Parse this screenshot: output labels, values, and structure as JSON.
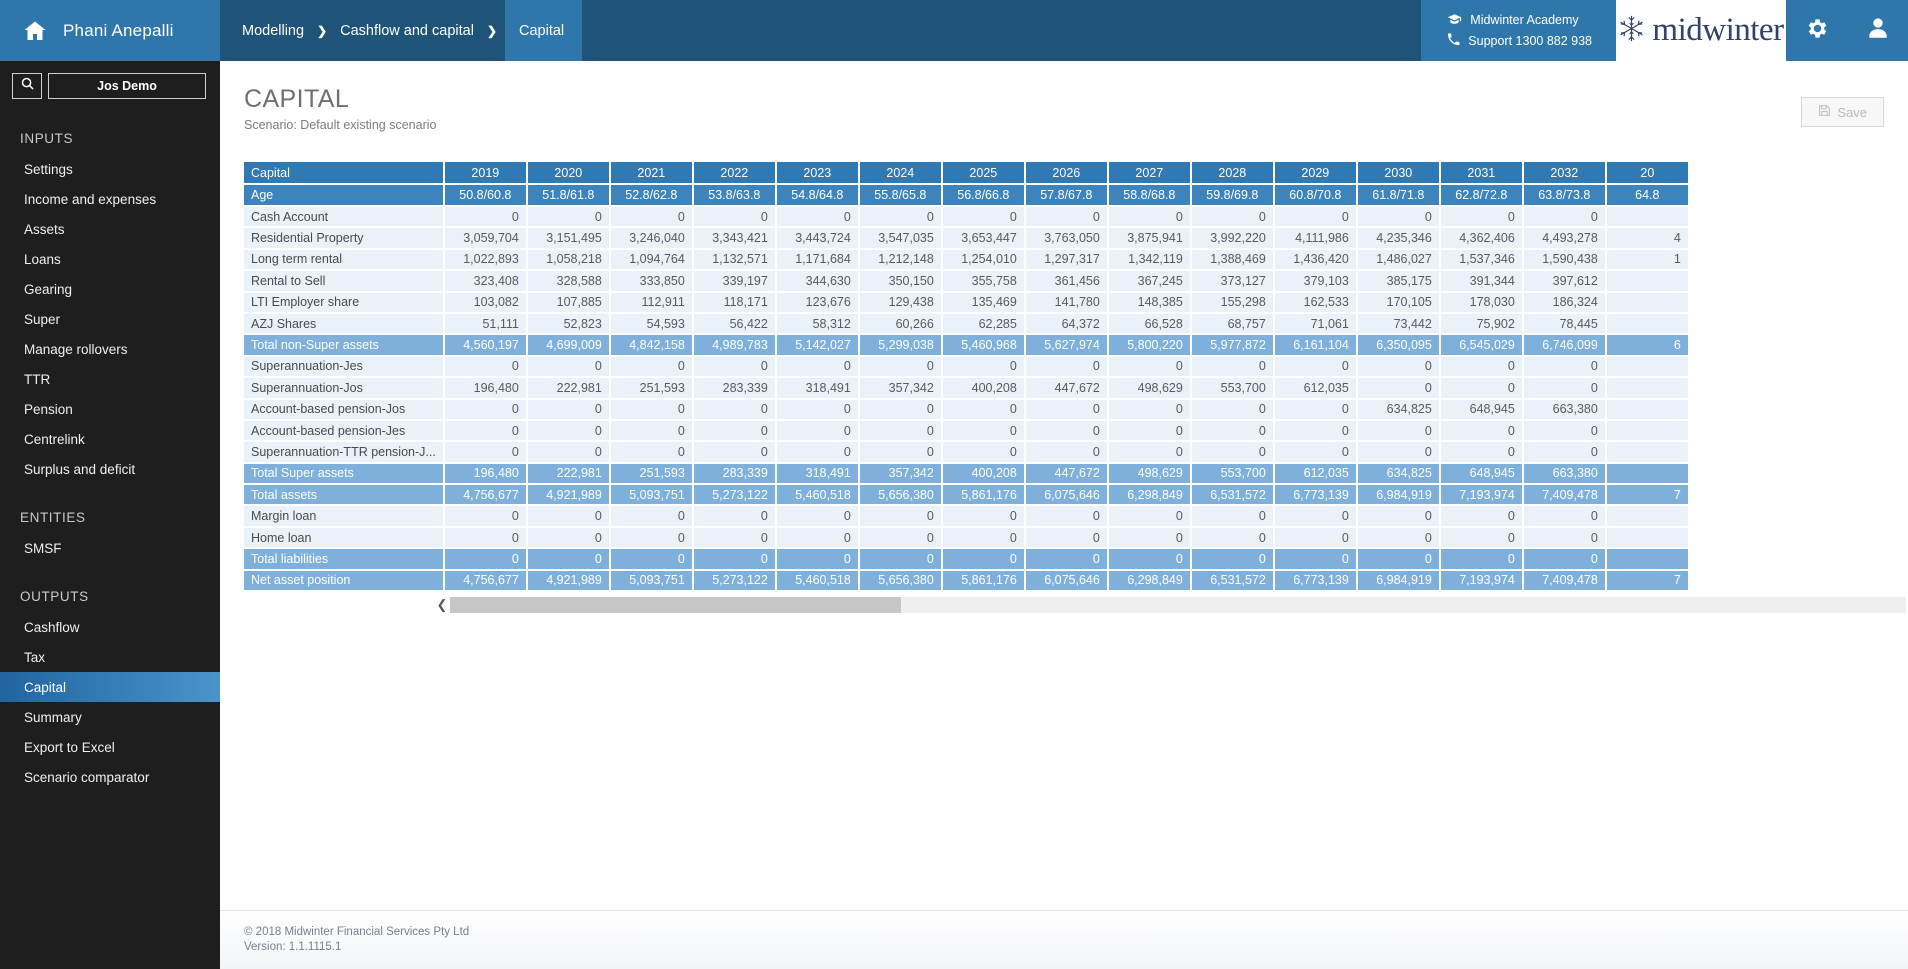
{
  "header": {
    "brand_name": "Phani Anepalli",
    "home_icon": "home-icon",
    "breadcrumbs": [
      "Modelling",
      "Cashflow and capital",
      "Capital"
    ],
    "crumb_separator": "❯",
    "academy_label": "Midwinter Academy",
    "academy_icon": "graduation-cap-icon",
    "support_label": "Support 1300 882 938",
    "support_icon": "phone-icon",
    "logo_text": "midwinter",
    "logo_icon": "snowflake-icon",
    "settings_icon": "gear-icon",
    "user_icon": "user-icon"
  },
  "sidebar": {
    "search_icon": "search-icon",
    "client_label": "Jos Demo",
    "groups": [
      {
        "title": "INPUTS",
        "items": [
          "Settings",
          "Income and expenses",
          "Assets",
          "Loans",
          "Gearing",
          "Super",
          "Manage rollovers",
          "TTR",
          "Pension",
          "Centrelink",
          "Surplus and deficit"
        ]
      },
      {
        "title": "ENTITIES",
        "items": [
          "SMSF"
        ]
      },
      {
        "title": "OUTPUTS",
        "items": [
          "Cashflow",
          "Tax",
          "Capital",
          "Summary",
          "Export to Excel",
          "Scenario comparator"
        ]
      }
    ],
    "active_item": "Capital"
  },
  "page": {
    "title": "CAPITAL",
    "subtitle": "Scenario: Default existing scenario",
    "save_label": "Save",
    "save_icon": "floppy-disk-icon"
  },
  "table": {
    "corner_label": "Capital",
    "years": [
      "2019",
      "2020",
      "2021",
      "2022",
      "2023",
      "2024",
      "2025",
      "2026",
      "2027",
      "2028",
      "2029",
      "2030",
      "2031",
      "2032",
      "20"
    ],
    "age_label": "Age",
    "ages": [
      "50.8/60.8",
      "51.8/61.8",
      "52.8/62.8",
      "53.8/63.8",
      "54.8/64.8",
      "55.8/65.8",
      "56.8/66.8",
      "57.8/67.8",
      "58.8/68.8",
      "59.8/69.8",
      "60.8/70.8",
      "61.8/71.8",
      "62.8/72.8",
      "63.8/73.8",
      "64.8"
    ],
    "rows": [
      {
        "label": "Cash Account",
        "type": "data",
        "values": [
          "0",
          "0",
          "0",
          "0",
          "0",
          "0",
          "0",
          "0",
          "0",
          "0",
          "0",
          "0",
          "0",
          "0",
          ""
        ]
      },
      {
        "label": "Residential Property",
        "type": "data",
        "values": [
          "3,059,704",
          "3,151,495",
          "3,246,040",
          "3,343,421",
          "3,443,724",
          "3,547,035",
          "3,653,447",
          "3,763,050",
          "3,875,941",
          "3,992,220",
          "4,111,986",
          "4,235,346",
          "4,362,406",
          "4,493,278",
          "4"
        ]
      },
      {
        "label": "Long term rental",
        "type": "data",
        "values": [
          "1,022,893",
          "1,058,218",
          "1,094,764",
          "1,132,571",
          "1,171,684",
          "1,212,148",
          "1,254,010",
          "1,297,317",
          "1,342,119",
          "1,388,469",
          "1,436,420",
          "1,486,027",
          "1,537,346",
          "1,590,438",
          "1"
        ]
      },
      {
        "label": "Rental to Sell",
        "type": "data",
        "values": [
          "323,408",
          "328,588",
          "333,850",
          "339,197",
          "344,630",
          "350,150",
          "355,758",
          "361,456",
          "367,245",
          "373,127",
          "379,103",
          "385,175",
          "391,344",
          "397,612",
          ""
        ]
      },
      {
        "label": "LTI Employer share",
        "type": "data",
        "values": [
          "103,082",
          "107,885",
          "112,911",
          "118,171",
          "123,676",
          "129,438",
          "135,469",
          "141,780",
          "148,385",
          "155,298",
          "162,533",
          "170,105",
          "178,030",
          "186,324",
          ""
        ]
      },
      {
        "label": "AZJ Shares",
        "type": "data",
        "values": [
          "51,111",
          "52,823",
          "54,593",
          "56,422",
          "58,312",
          "60,266",
          "62,285",
          "64,372",
          "66,528",
          "68,757",
          "71,061",
          "73,442",
          "75,902",
          "78,445",
          ""
        ]
      },
      {
        "label": "Total non-Super assets",
        "type": "total",
        "values": [
          "4,560,197",
          "4,699,009",
          "4,842,158",
          "4,989,783",
          "5,142,027",
          "5,299,038",
          "5,460,968",
          "5,627,974",
          "5,800,220",
          "5,977,872",
          "6,161,104",
          "6,350,095",
          "6,545,029",
          "6,746,099",
          "6"
        ]
      },
      {
        "label": "Superannuation-Jes",
        "type": "data",
        "values": [
          "0",
          "0",
          "0",
          "0",
          "0",
          "0",
          "0",
          "0",
          "0",
          "0",
          "0",
          "0",
          "0",
          "0",
          ""
        ]
      },
      {
        "label": "Superannuation-Jos",
        "type": "data",
        "values": [
          "196,480",
          "222,981",
          "251,593",
          "283,339",
          "318,491",
          "357,342",
          "400,208",
          "447,672",
          "498,629",
          "553,700",
          "612,035",
          "0",
          "0",
          "0",
          ""
        ]
      },
      {
        "label": "Account-based pension-Jos",
        "type": "data",
        "values": [
          "0",
          "0",
          "0",
          "0",
          "0",
          "0",
          "0",
          "0",
          "0",
          "0",
          "0",
          "634,825",
          "648,945",
          "663,380",
          ""
        ]
      },
      {
        "label": "Account-based pension-Jes",
        "type": "data",
        "values": [
          "0",
          "0",
          "0",
          "0",
          "0",
          "0",
          "0",
          "0",
          "0",
          "0",
          "0",
          "0",
          "0",
          "0",
          ""
        ]
      },
      {
        "label": "Superannuation-TTR pension-J...",
        "type": "data",
        "values": [
          "0",
          "0",
          "0",
          "0",
          "0",
          "0",
          "0",
          "0",
          "0",
          "0",
          "0",
          "0",
          "0",
          "0",
          ""
        ]
      },
      {
        "label": "Total Super assets",
        "type": "total",
        "values": [
          "196,480",
          "222,981",
          "251,593",
          "283,339",
          "318,491",
          "357,342",
          "400,208",
          "447,672",
          "498,629",
          "553,700",
          "612,035",
          "634,825",
          "648,945",
          "663,380",
          ""
        ]
      },
      {
        "label": "Total assets",
        "type": "total",
        "values": [
          "4,756,677",
          "4,921,989",
          "5,093,751",
          "5,273,122",
          "5,460,518",
          "5,656,380",
          "5,861,176",
          "6,075,646",
          "6,298,849",
          "6,531,572",
          "6,773,139",
          "6,984,919",
          "7,193,974",
          "7,409,478",
          "7"
        ]
      },
      {
        "label": "Margin loan",
        "type": "data",
        "values": [
          "0",
          "0",
          "0",
          "0",
          "0",
          "0",
          "0",
          "0",
          "0",
          "0",
          "0",
          "0",
          "0",
          "0",
          ""
        ]
      },
      {
        "label": "Home loan",
        "type": "data",
        "values": [
          "0",
          "0",
          "0",
          "0",
          "0",
          "0",
          "0",
          "0",
          "0",
          "0",
          "0",
          "0",
          "0",
          "0",
          ""
        ]
      },
      {
        "label": "Total liabilities",
        "type": "total",
        "values": [
          "0",
          "0",
          "0",
          "0",
          "0",
          "0",
          "0",
          "0",
          "0",
          "0",
          "0",
          "0",
          "0",
          "0",
          ""
        ]
      },
      {
        "label": "Net asset position",
        "type": "total",
        "values": [
          "4,756,677",
          "4,921,989",
          "5,093,751",
          "5,273,122",
          "5,460,518",
          "5,656,380",
          "5,861,176",
          "6,075,646",
          "6,298,849",
          "6,531,572",
          "6,773,139",
          "6,984,919",
          "7,193,974",
          "7,409,478",
          "7"
        ]
      }
    ],
    "scroll_left_icon": "chevron-left-icon",
    "scroll_right_icon": "chevron-right-icon"
  },
  "footer": {
    "copyright": "© 2018 Midwinter Financial Services Pty Ltd",
    "version": "Version: 1.1.1115.1"
  },
  "colors": {
    "brand_blue": "#2f77ab",
    "crumb_blue": "#1f5378",
    "sidebar_dark": "#1e1e1e",
    "header_blue": "#2f7ab5",
    "total_blue": "#7fb0dc",
    "cell_bg": "#eaf1f8",
    "logo_navy": "#32426a"
  }
}
